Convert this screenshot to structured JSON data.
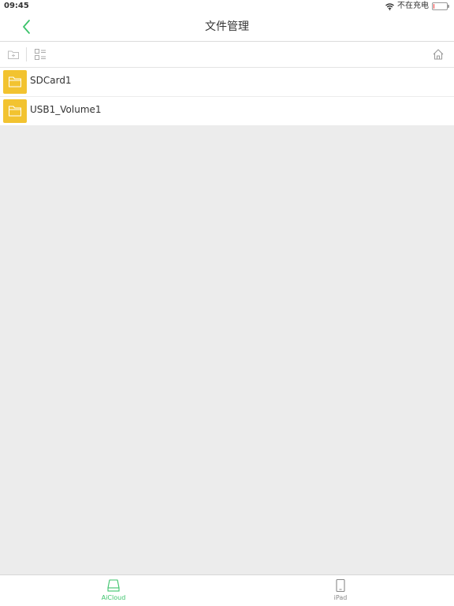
{
  "status": {
    "time": "09:45",
    "carrier_text": "不在充电",
    "battery_level": 0.08
  },
  "nav": {
    "title": "文件管理",
    "back_icon": "chevron-left-icon"
  },
  "toolbar": {
    "new_folder_icon": "folder-add-icon",
    "list_view_icon": "list-view-icon",
    "home_icon": "home-icon"
  },
  "files": [
    {
      "name": "SDCard1",
      "icon": "folder-icon"
    },
    {
      "name": "USB1_Volume1",
      "icon": "folder-icon"
    }
  ],
  "tabs": [
    {
      "label": "AiCloud",
      "icon": "drive-icon",
      "active": true
    },
    {
      "label": "iPad",
      "icon": "tablet-icon",
      "active": false
    }
  ],
  "colors": {
    "accent": "#3cc36b",
    "folder": "#f2c330",
    "inactive": "#888888",
    "background": "#ececec"
  }
}
